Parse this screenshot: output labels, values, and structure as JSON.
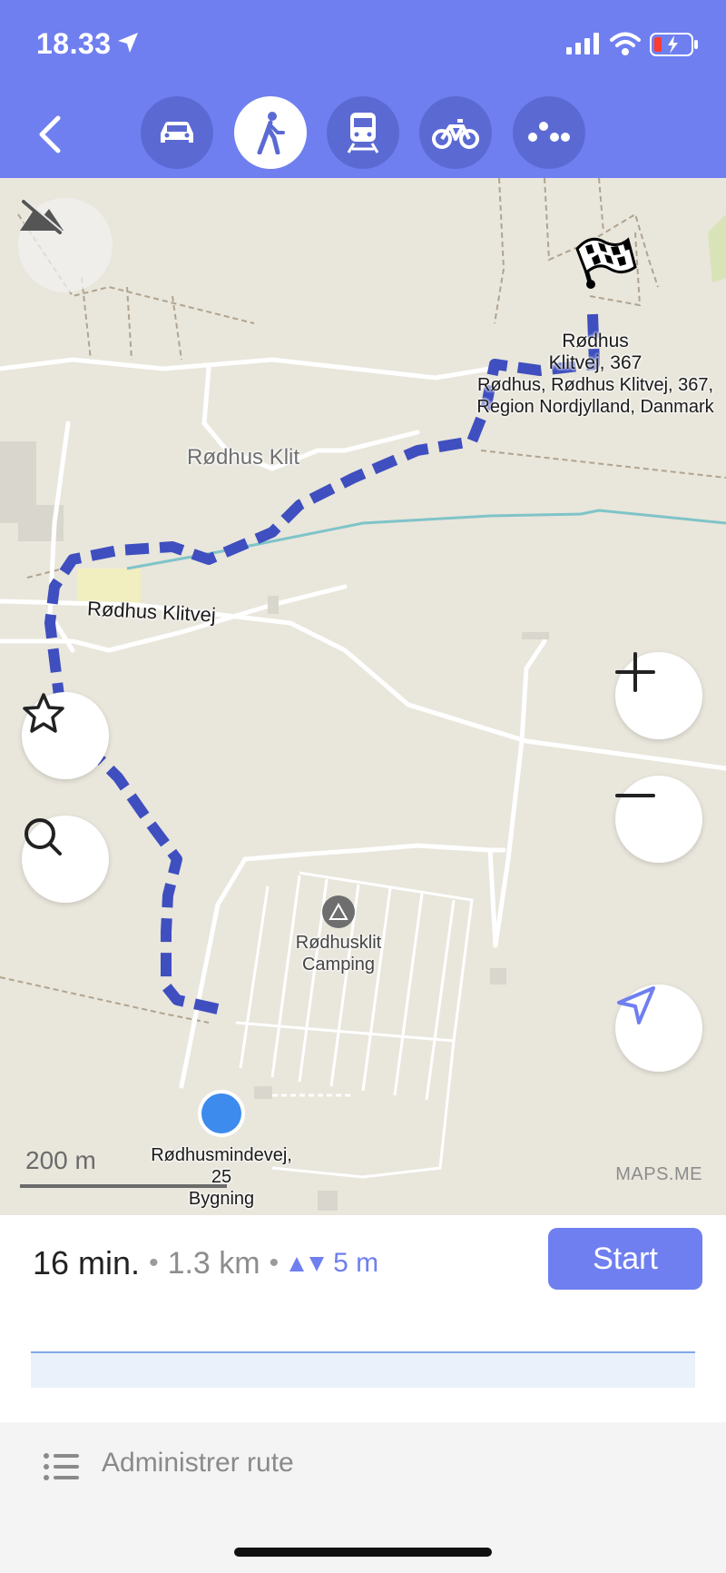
{
  "status_bar": {
    "time": "18.33"
  },
  "toolbar": {
    "back_icon": "chevron-left-icon",
    "modes": [
      {
        "name": "car",
        "icon": "car-icon",
        "active": false
      },
      {
        "name": "walk",
        "icon": "pedestrian-icon",
        "active": true
      },
      {
        "name": "transit",
        "icon": "train-icon",
        "active": false
      },
      {
        "name": "bike",
        "icon": "bicycle-icon",
        "active": false
      },
      {
        "name": "more",
        "icon": "more-dots-icon",
        "active": false
      }
    ]
  },
  "map": {
    "place_label": "Rødhus Klit",
    "road_label": "Rødhus Klitvej",
    "destination": {
      "name_line1": "Rødhus",
      "name_line2": "Klitvej, 367",
      "address_line1": "Rødhus, Rødhus Klitvej, 367,",
      "address_line2": "Region Nordjylland, Danmark"
    },
    "camping": {
      "line1": "Rødhusklit",
      "line2": "Camping"
    },
    "origin": {
      "line1": "Rødhusmindevej,",
      "line2": "25",
      "line3": "Bygning"
    },
    "scale_label": "200 m",
    "attribution": "MAPS.ME",
    "route_color": "#3f4fbf"
  },
  "route_summary": {
    "time": "16 min.",
    "distance": "1.3 km",
    "elevation": "5 m",
    "start_label": "Start"
  },
  "manage": {
    "label": "Administrer rute"
  },
  "colors": {
    "accent": "#6f7ff0",
    "map_bg": "#e9e6dc",
    "origin_dot": "#3d8bed"
  }
}
